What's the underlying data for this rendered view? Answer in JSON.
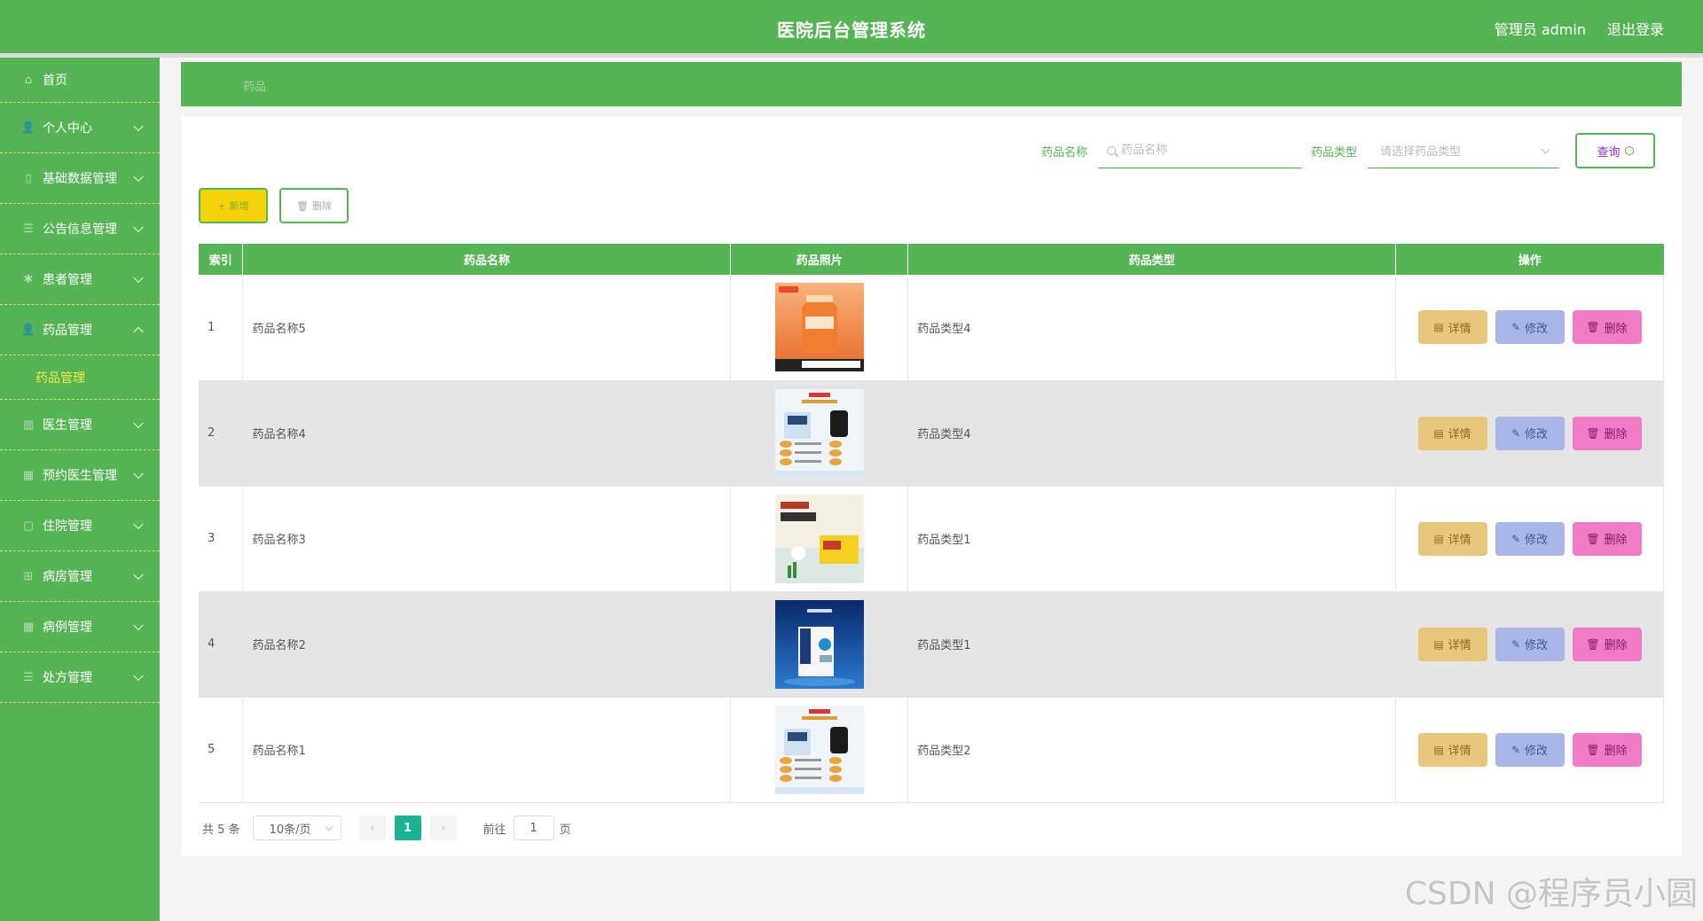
{
  "header": {
    "title": "医院后台管理系统",
    "admin_label": "管理员 admin",
    "logout_label": "退出登录"
  },
  "sidebar": {
    "items": [
      {
        "label": "首页",
        "icon": "home-icon"
      },
      {
        "label": "个人中心",
        "icon": "user-icon"
      },
      {
        "label": "基础数据管理",
        "icon": "data-icon"
      },
      {
        "label": "公告信息管理",
        "icon": "notice-icon"
      },
      {
        "label": "患者管理",
        "icon": "patient-icon"
      },
      {
        "label": "药品管理",
        "icon": "medicine-icon",
        "expanded": true
      },
      {
        "label": "医生管理",
        "icon": "doctor-icon"
      },
      {
        "label": "预约医生管理",
        "icon": "appointment-icon"
      },
      {
        "label": "住院管理",
        "icon": "hospital-icon"
      },
      {
        "label": "病房管理",
        "icon": "ward-icon"
      },
      {
        "label": "病例管理",
        "icon": "case-icon"
      },
      {
        "label": "处方管理",
        "icon": "prescription-icon"
      }
    ],
    "submenu_label": "药品管理"
  },
  "breadcrumb": {
    "current": "药品"
  },
  "search": {
    "name_label": "药品名称",
    "name_placeholder": "药品名称",
    "type_label": "药品类型",
    "type_placeholder": "请选择药品类型",
    "query_label": "查询"
  },
  "actions": {
    "add_label": "新增",
    "delete_label": "删除"
  },
  "table": {
    "headers": [
      "索引",
      "药品名称",
      "药品照片",
      "药品类型",
      "操作"
    ],
    "rows": [
      {
        "index": "1",
        "name": "药品名称5",
        "type": "药品类型4",
        "image": "orange-bottle"
      },
      {
        "index": "2",
        "name": "药品名称4",
        "type": "药品类型4",
        "image": "supplement-box"
      },
      {
        "index": "3",
        "name": "药品名称3",
        "type": "药品类型1",
        "image": "yellow-box"
      },
      {
        "index": "4",
        "name": "药品名称2",
        "type": "药品类型1",
        "image": "blue-box"
      },
      {
        "index": "5",
        "name": "药品名称1",
        "type": "药品类型2",
        "image": "supplement-box"
      }
    ],
    "op_detail": "详情",
    "op_edit": "修改",
    "op_delete": "删除"
  },
  "pagination": {
    "total": "共 5 条",
    "page_size": "10条/页",
    "current_page": "1",
    "goto_label": "前往",
    "goto_value": "1",
    "page_suffix": "页"
  },
  "watermark": "CSDN @程序员小圆",
  "colors": {
    "primary": "#55b454",
    "add": "#f5d20a",
    "detail": "#e8c77a",
    "edit": "#aab5e8",
    "remove": "#f07cc8",
    "page_active": "#1ab394"
  }
}
